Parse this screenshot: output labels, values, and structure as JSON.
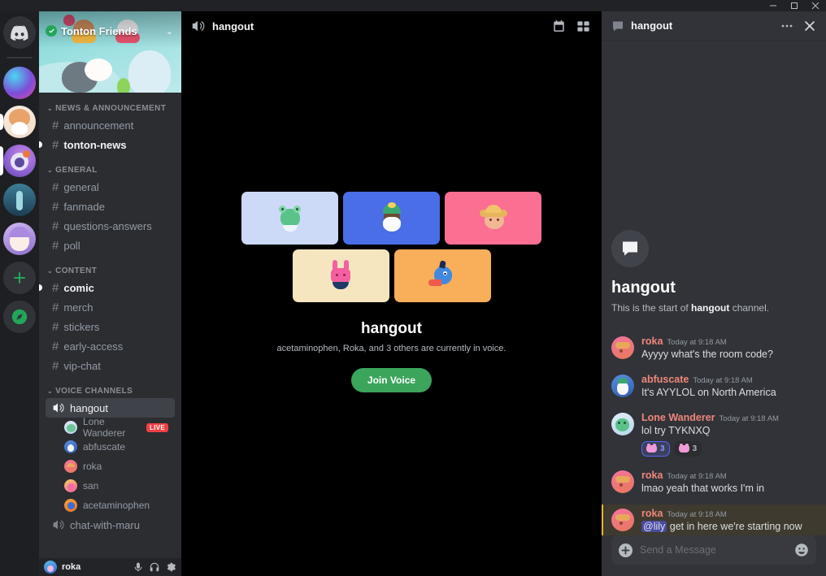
{
  "window": {
    "app_name": "Discord",
    "minimize_label": "Minimize",
    "maximize_label": "Maximize",
    "close_label": "Close"
  },
  "server_rail": {
    "home_label": "Direct Messages",
    "servers": [
      {
        "name": "server-1",
        "colors": [
          "#7b4dd8",
          "#35d6e0"
        ],
        "active": false,
        "unread": false
      },
      {
        "name": "server-2",
        "colors": [
          "#f5d6c0",
          "#e8a36a"
        ],
        "active": false,
        "unread": true
      },
      {
        "name": "server-3",
        "colors": [
          "#b07ad8",
          "#6d5bd0"
        ],
        "active": true,
        "unread": false
      },
      {
        "name": "server-4",
        "colors": [
          "#2b5f7a",
          "#4fb3c9"
        ],
        "active": false,
        "unread": false
      },
      {
        "name": "server-5",
        "colors": [
          "#d8c5f0",
          "#9b7ad8"
        ],
        "active": false,
        "unread": false
      }
    ],
    "add_server_label": "+",
    "explore_label": "Explore Discoverable Servers"
  },
  "sidebar": {
    "server_name": "Tonton Friends",
    "verified": true,
    "dropdown_label": "Server options",
    "categories": [
      {
        "label": "NEWS & ANNOUNCEMENT",
        "channels": [
          {
            "name": "announcement",
            "type": "text",
            "state": "read"
          },
          {
            "name": "tonton-news",
            "type": "text",
            "state": "unread"
          }
        ]
      },
      {
        "label": "GENERAL",
        "channels": [
          {
            "name": "general",
            "type": "text",
            "state": "read"
          },
          {
            "name": "fanmade",
            "type": "text",
            "state": "read"
          },
          {
            "name": "questions-answers",
            "type": "text",
            "state": "read"
          },
          {
            "name": "poll",
            "type": "text",
            "state": "read"
          }
        ]
      },
      {
        "label": "CONTENT",
        "channels": [
          {
            "name": "comic",
            "type": "text",
            "state": "unread"
          },
          {
            "name": "merch",
            "type": "text",
            "state": "read"
          },
          {
            "name": "stickers",
            "type": "text",
            "state": "read"
          },
          {
            "name": "early-access",
            "type": "text",
            "state": "read"
          },
          {
            "name": "vip-chat",
            "type": "text",
            "state": "read"
          }
        ]
      },
      {
        "label": "VOICE CHANNELS",
        "channels": [
          {
            "name": "hangout",
            "type": "voice",
            "state": "selected"
          },
          {
            "name": "chat-with-maru",
            "type": "voice",
            "state": "read"
          }
        ]
      }
    ],
    "voice_members": [
      {
        "name": "Lone Wanderer",
        "badge": "LIVE",
        "colors": [
          "#cfe3f5",
          "#8fd4b0"
        ]
      },
      {
        "name": "abfuscate",
        "badge": "",
        "colors": [
          "#4a7fd8",
          "#2e5bb0"
        ]
      },
      {
        "name": "roka",
        "badge": "",
        "colors": [
          "#f06292",
          "#e8795a"
        ]
      },
      {
        "name": "san",
        "badge": "",
        "colors": [
          "#f5c842",
          "#ef5ba0"
        ]
      },
      {
        "name": "acetaminophen",
        "badge": "",
        "colors": [
          "#f09a3a",
          "#3d5bd8"
        ]
      }
    ]
  },
  "user_panel": {
    "username": "roka",
    "mute_label": "Mute",
    "deafen_label": "Deafen",
    "settings_label": "User Settings"
  },
  "main": {
    "header": {
      "channel_name": "hangout",
      "events_label": "Events",
      "layout_label": "Change Layout"
    },
    "tiles": [
      {
        "name": "Lone Wanderer",
        "bg": "#ccd9f7",
        "face": "frog"
      },
      {
        "name": "abfuscate",
        "bg": "#4a6ee8",
        "face": "wizard"
      },
      {
        "name": "roka",
        "bg": "#fb6f92",
        "face": "hat"
      },
      {
        "name": "san",
        "bg": "#f5e6c0",
        "face": "bunny"
      },
      {
        "name": "acetaminophen",
        "bg": "#f9ae5a",
        "face": "genie"
      }
    ],
    "channel_title": "hangout",
    "subtitle": "acetaminophen, Roka, and 3 others are currently in voice.",
    "join_button": "Join Voice"
  },
  "chat_panel": {
    "header_title": "hangout",
    "more_label": "More",
    "close_label": "Close",
    "welcome_title": "hangout",
    "welcome_prefix": "This is the start of ",
    "welcome_bold": "hangout",
    "welcome_suffix": " channel.",
    "messages": [
      {
        "author": "roka",
        "author_color": "#f0877c",
        "timestamp": "Today at 9:18 AM",
        "text": "Ayyyy what's the room code?",
        "avatar_colors": [
          "#f06292",
          "#e8795a"
        ],
        "highlight": false,
        "mention": "",
        "reactions": []
      },
      {
        "author": "abfuscate",
        "author_color": "#f0877c",
        "timestamp": "Today at 9:18 AM",
        "text": "It's AYYLOL on North America",
        "avatar_colors": [
          "#4a7fd8",
          "#2e5bb0"
        ],
        "highlight": false,
        "mention": "",
        "reactions": []
      },
      {
        "author": "Lone Wanderer",
        "author_color": "#f0877c",
        "timestamp": "Today at 9:18 AM",
        "text": "lol try TYKNXQ",
        "avatar_colors": [
          "#cfe3f5",
          "#8fd4b0"
        ],
        "highlight": false,
        "mention": "",
        "reactions": [
          {
            "emoji": "cat",
            "count": "3",
            "me": true
          },
          {
            "emoji": "cat",
            "count": "3",
            "me": false
          }
        ]
      },
      {
        "author": "roka",
        "author_color": "#f0877c",
        "timestamp": "Today at 9:18 AM",
        "text": "lmao yeah that works I'm in",
        "avatar_colors": [
          "#f06292",
          "#e8795a"
        ],
        "highlight": false,
        "mention": "",
        "reactions": []
      },
      {
        "author": "roka",
        "author_color": "#f0877c",
        "timestamp": "Today at 9:18 AM",
        "text": " get in here we're starting now",
        "avatar_colors": [
          "#f06292",
          "#e8795a"
        ],
        "highlight": true,
        "mention": "@lily",
        "reactions": []
      }
    ],
    "input_placeholder": "Send a Message",
    "attach_label": "Attach",
    "emoji_label": "Emoji"
  },
  "colors": {
    "accent_green": "#3ba55c",
    "live_red": "#f23f43",
    "mention_yellow": "#f0b232",
    "blurple": "#5865f2"
  }
}
